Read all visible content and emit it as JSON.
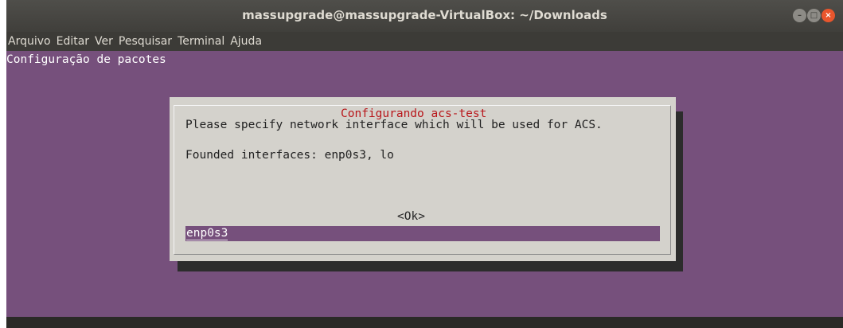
{
  "window": {
    "title": "massupgrade@massupgrade-VirtualBox: ~/Downloads"
  },
  "menu": [
    "Arquivo",
    "Editar",
    "Ver",
    "Pesquisar",
    "Terminal",
    "Ajuda"
  ],
  "terminal": {
    "backtitle": "Configuração de pacotes"
  },
  "dialog": {
    "title": "Configurando acs-test",
    "prompt": "Please specify network interface which will be used for ACS.",
    "info": "Founded interfaces: enp0s3, lo",
    "input_value": "enp0s3",
    "ok_label": "<Ok>"
  },
  "colors": {
    "terminal_bg": "#76507c",
    "dialog_bg": "#d4d2cc",
    "title_red": "#b8161a",
    "close_orange": "#e9562d"
  },
  "icons": {
    "minimize": "minimize-icon",
    "maximize": "maximize-icon",
    "close": "close-icon"
  }
}
